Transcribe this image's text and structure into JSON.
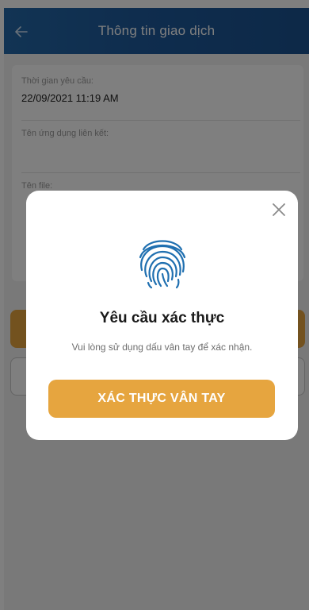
{
  "header": {
    "title": "Thông tin giao dịch",
    "back_icon": "arrow-left-icon"
  },
  "form": {
    "fields": [
      {
        "label": "Thời gian yêu cầu:",
        "value": "22/09/2021 11:19 AM"
      },
      {
        "label": "Tên ứng dụng liên kết:",
        "value": ""
      },
      {
        "label": "Tên file:",
        "value": ""
      }
    ]
  },
  "modal": {
    "close_icon": "close-icon",
    "fingerprint_icon": "fingerprint-icon",
    "title": "Yêu cầu xác thực",
    "description": "Vui lòng sử dụng dấu vân tay để xác nhận.",
    "confirm_label": "XÁC THỰC VÂN TAY"
  },
  "colors": {
    "header": "#1e5a9c",
    "accent": "#e6a53f",
    "fingerprint": "#1f6fb0",
    "overlay": "rgba(0,0,0,0.5)"
  }
}
